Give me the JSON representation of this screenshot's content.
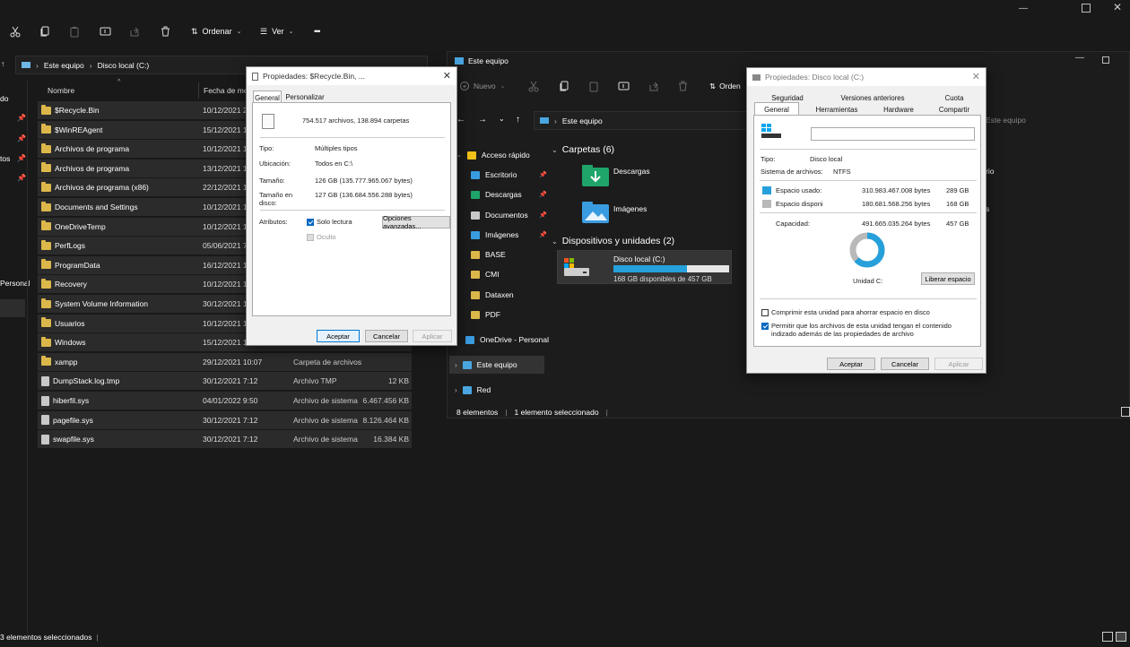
{
  "window_back": {
    "toolbar": {
      "sort_label": "Ordenar",
      "view_label": "Ver",
      "more_label": "•••"
    },
    "address": {
      "crumbs": [
        "Este equipo",
        "Disco local (C:)"
      ]
    },
    "side_fragments": [
      "do",
      "tos",
      "Personal"
    ],
    "columns": {
      "name": "Nombre",
      "date": "Fecha de mo"
    },
    "rows": [
      {
        "name": "$Recycle.Bin",
        "date": "10/12/2021 2",
        "type": "",
        "size": "",
        "icon": "folder-icon"
      },
      {
        "name": "$WinREAgent",
        "date": "15/12/2021 1",
        "type": "",
        "size": "",
        "icon": "folder-icon"
      },
      {
        "name": "Archivos de programa",
        "date": "10/12/2021 1",
        "type": "",
        "size": "",
        "icon": "folder-shortcut-icon"
      },
      {
        "name": "Archivos de programa",
        "date": "13/12/2021 1",
        "type": "",
        "size": "",
        "icon": "folder-icon"
      },
      {
        "name": "Archivos de programa (x86)",
        "date": "22/12/2021 1",
        "type": "",
        "size": "",
        "icon": "folder-icon"
      },
      {
        "name": "Documents and Settings",
        "date": "10/12/2021 1",
        "type": "",
        "size": "",
        "icon": "folder-shortcut-icon"
      },
      {
        "name": "OneDriveTemp",
        "date": "10/12/2021 1",
        "type": "",
        "size": "",
        "icon": "folder-icon"
      },
      {
        "name": "PerfLogs",
        "date": "05/06/2021 7",
        "type": "",
        "size": "",
        "icon": "folder-icon"
      },
      {
        "name": "ProgramData",
        "date": "16/12/2021 1",
        "type": "",
        "size": "",
        "icon": "folder-icon"
      },
      {
        "name": "Recovery",
        "date": "10/12/2021 1",
        "type": "",
        "size": "",
        "icon": "folder-icon"
      },
      {
        "name": "System Volume Information",
        "date": "30/12/2021 1",
        "type": "",
        "size": "",
        "icon": "folder-icon"
      },
      {
        "name": "Usuarios",
        "date": "10/12/2021 1",
        "type": "",
        "size": "",
        "icon": "folder-icon"
      },
      {
        "name": "Windows",
        "date": "15/12/2021 1",
        "type": "",
        "size": "",
        "icon": "folder-icon"
      },
      {
        "name": "xampp",
        "date": "29/12/2021 10:07",
        "type": "Carpeta de archivos",
        "size": "",
        "icon": "folder-icon"
      },
      {
        "name": "DumpStack.log.tmp",
        "date": "30/12/2021 7:12",
        "type": "Archivo TMP",
        "size": "12 KB",
        "icon": "file-icon"
      },
      {
        "name": "hiberfil.sys",
        "date": "04/01/2022 9:50",
        "type": "Archivo de sistema",
        "size": "6.467.456 KB",
        "icon": "file-icon"
      },
      {
        "name": "pagefile.sys",
        "date": "30/12/2021 7:12",
        "type": "Archivo de sistema",
        "size": "8.126.464 KB",
        "icon": "file-icon"
      },
      {
        "name": "swapfile.sys",
        "date": "30/12/2021 7:12",
        "type": "Archivo de sistema",
        "size": "16.384 KB",
        "icon": "file-icon"
      }
    ],
    "status": "3 elementos seleccionados"
  },
  "window_front": {
    "title": "Este equipo",
    "toolbar": {
      "new_label": "Nuevo",
      "sort_label": "Orden"
    },
    "address": {
      "crumb": "Este equipo",
      "search_placeholder": "Este equipo"
    },
    "nav": [
      {
        "label": "Acceso rápido",
        "icon": "star-icon"
      },
      {
        "label": "Escritorio",
        "icon": "desktop-icon",
        "pinned": true
      },
      {
        "label": "Descargas",
        "icon": "download-icon",
        "pinned": true
      },
      {
        "label": "Documentos",
        "icon": "document-icon",
        "pinned": true
      },
      {
        "label": "Imágenes",
        "icon": "image-icon",
        "pinned": true
      },
      {
        "label": "BASE",
        "icon": "folder-icon"
      },
      {
        "label": "CMI",
        "icon": "folder-icon"
      },
      {
        "label": "Dataxen",
        "icon": "folder-icon"
      },
      {
        "label": "PDF",
        "icon": "folder-icon"
      },
      {
        "label": "OneDrive - Personal",
        "icon": "cloud-icon"
      },
      {
        "label": "Este equipo",
        "icon": "computer-icon"
      },
      {
        "label": "Red",
        "icon": "network-icon"
      }
    ],
    "folders_header": "Carpetas (6)",
    "folders": [
      {
        "label": "Descargas"
      },
      {
        "label": "Imágenes"
      }
    ],
    "drives_header": "Dispositivos y unidades (2)",
    "drive": {
      "label": "Disco local (C:)",
      "free": "168 GB disponibles de 457 GB",
      "used_fraction": 0.632
    },
    "right_fragments": [
      "torio",
      "s"
    ],
    "status": {
      "count": "8 elementos",
      "selected": "1 elemento seleccionado"
    }
  },
  "dialog_recycle": {
    "title": "Propiedades: $Recycle.Bin, ...",
    "tabs": [
      "General",
      "Personalizar"
    ],
    "summary": "754.517 archivos, 138.894 carpetas",
    "fields": [
      {
        "label": "Tipo:",
        "value": "Múltiples tipos"
      },
      {
        "label": "Ubicación:",
        "value": "Todos en C:\\"
      },
      {
        "label": "Tamaño:",
        "value": "126 GB (135.777.965.067 bytes)"
      },
      {
        "label": "Tamaño en disco:",
        "value": "127 GB (136.684.556.288 bytes)"
      }
    ],
    "attributes_label": "Atributos:",
    "readonly_label": "Solo lectura",
    "hidden_label": "Oculto",
    "advanced_label": "Opciones avanzadas...",
    "buttons": {
      "ok": "Aceptar",
      "cancel": "Cancelar",
      "apply": "Aplicar"
    }
  },
  "dialog_disk": {
    "title": "Propiedades: Disco local (C:)",
    "tabs_top": [
      "Seguridad",
      "Versiones anteriores",
      "Cuota"
    ],
    "tabs_bottom": [
      "General",
      "Herramientas",
      "Hardware",
      "Compartir"
    ],
    "name_value": "",
    "type_label": "Tipo:",
    "type_value": "Disco local",
    "fs_label": "Sistema de archivos:",
    "fs_value": "NTFS",
    "used_label": "Espacio usado:",
    "used_bytes": "310.983.467.008 bytes",
    "used_size": "289 GB",
    "free_label": "Espacio disponi",
    "free_bytes": "180.681.568.256 bytes",
    "free_size": "168 GB",
    "capacity_label": "Capacidad:",
    "capacity_bytes": "491.665.035.264 bytes",
    "capacity_size": "457 GB",
    "used_fraction": 0.632,
    "drive_label": "Unidad C:",
    "cleanup_label": "Liberar espacio",
    "compress_label": "Comprimir esta unidad para ahorrar espacio en disco",
    "index_label": "Permitir que los archivos de esta unidad tengan el contenido indizado además de las propiedades de archivo",
    "buttons": {
      "ok": "Aceptar",
      "cancel": "Cancelar",
      "apply": "Aplicar"
    },
    "colors": {
      "used": "#26a0da",
      "free": "#b9b9b9"
    }
  }
}
